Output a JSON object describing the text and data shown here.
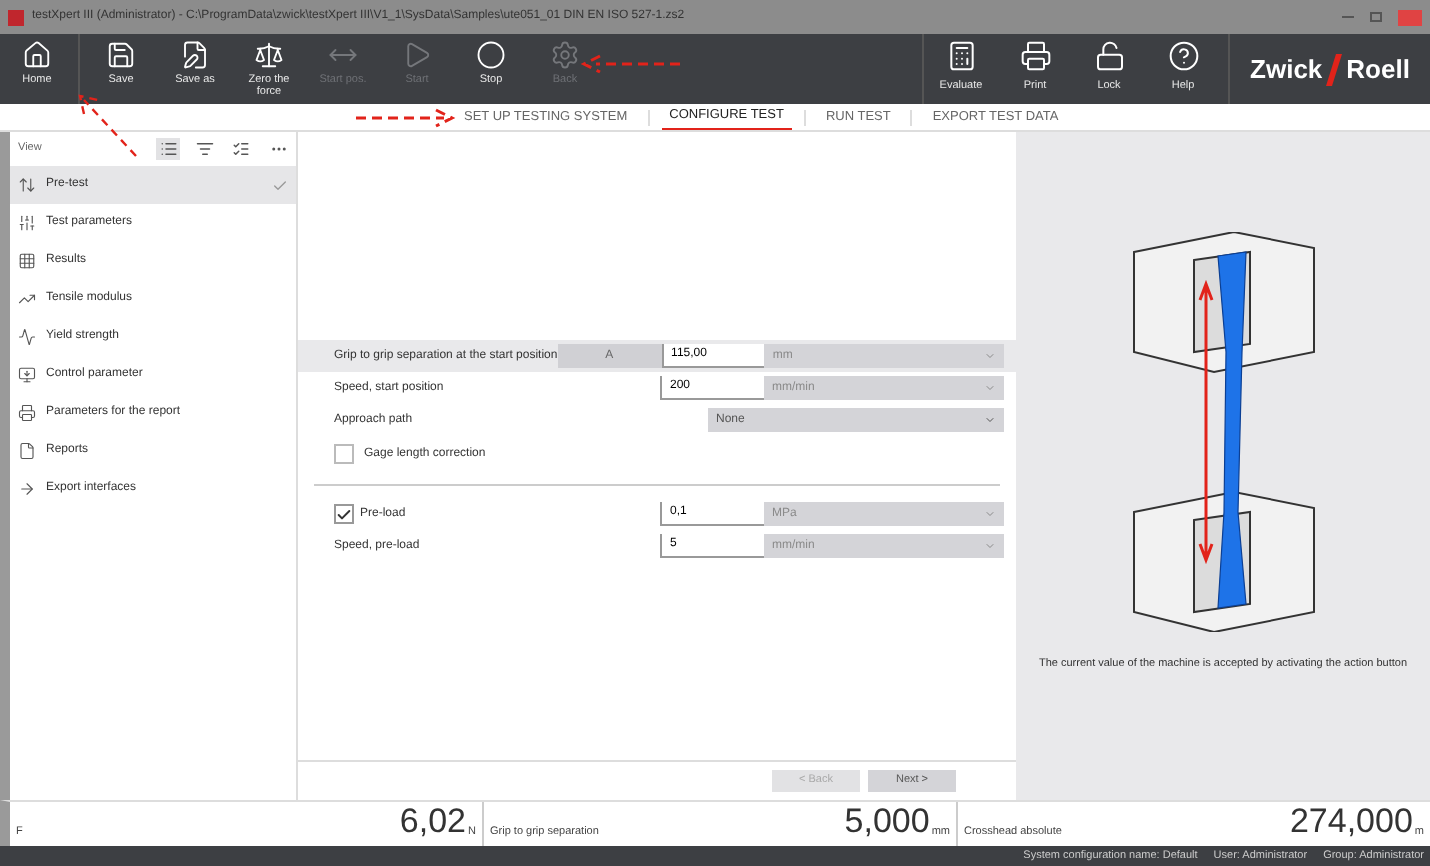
{
  "window": {
    "title": "testXpert III (Administrator) - C:\\ProgramData\\zwick\\testXpert III\\V1_1\\SysData\\Samples\\ute051_01 DIN EN ISO 527-1.zs2"
  },
  "toolbar": [
    {
      "label": "Home",
      "disabled": false
    },
    {
      "label": "Save",
      "disabled": false
    },
    {
      "label": "Save as",
      "disabled": false
    },
    {
      "label": "Zero the force",
      "disabled": false
    },
    {
      "label": "Start pos.",
      "disabled": true
    },
    {
      "label": "Start",
      "disabled": true
    },
    {
      "label": "Stop",
      "disabled": false
    },
    {
      "label": "Back",
      "disabled": true
    }
  ],
  "toolbar_right": [
    {
      "label": "Evaluate"
    },
    {
      "label": "Print"
    },
    {
      "label": "Lock"
    },
    {
      "label": "Help"
    }
  ],
  "logo": {
    "left": "Zwick",
    "right": "Roell"
  },
  "tabs": [
    {
      "label": "SET UP TESTING SYSTEM",
      "selected": false
    },
    {
      "label": "CONFIGURE TEST",
      "selected": true
    },
    {
      "label": "RUN TEST",
      "selected": false
    },
    {
      "label": "EXPORT TEST DATA",
      "selected": false
    }
  ],
  "sidebar": {
    "view_label": "View",
    "views": [
      {
        "selected": true
      },
      {
        "selected": false
      },
      {
        "selected": false
      }
    ],
    "items": [
      {
        "label": "Pre-test",
        "selected": true,
        "checked": true
      },
      {
        "label": "Test parameters",
        "selected": false,
        "checked": false
      },
      {
        "label": "Results",
        "selected": false,
        "checked": false
      },
      {
        "label": "Tensile modulus",
        "selected": false,
        "checked": false
      },
      {
        "label": "Yield strength",
        "selected": false,
        "checked": false
      },
      {
        "label": "Control parameter",
        "selected": false,
        "checked": false
      },
      {
        "label": "Parameters for the report",
        "selected": false,
        "checked": false
      },
      {
        "label": "Reports",
        "selected": false,
        "checked": false
      },
      {
        "label": "Export interfaces",
        "selected": false,
        "checked": false
      }
    ]
  },
  "form": [
    {
      "kind": "value",
      "label": "Grip to grip separation at the start position",
      "selected": true,
      "action": "A",
      "value": "115,00",
      "unit": "mm"
    },
    {
      "kind": "value",
      "label": "Speed, start position",
      "selected": false,
      "value": "200",
      "unit": "mm/min"
    },
    {
      "kind": "select",
      "label": "Approach path",
      "selected": false,
      "value": "None"
    },
    {
      "kind": "check",
      "label": "Gage length correction",
      "checked": false
    },
    {
      "kind": "divider"
    },
    {
      "kind": "checkvalue",
      "label": "Pre-load",
      "checked": true,
      "value": "0,1",
      "unit": "MPa"
    },
    {
      "kind": "value",
      "label": "Speed, pre-load",
      "selected": false,
      "value": "5",
      "unit": "mm/min"
    }
  ],
  "nav_buttons": [
    {
      "label": "< Back",
      "disabled": true
    },
    {
      "label": "Next >",
      "disabled": false
    }
  ],
  "caption": "The current value of the machine is accepted by activating the action button",
  "readouts": [
    {
      "label": "F",
      "value": "6,02",
      "unit": "N"
    },
    {
      "label": "Grip to grip separation",
      "value": "5,000",
      "unit": "mm"
    },
    {
      "label": "Crosshead absolute",
      "value": "274,000",
      "unit": "m"
    }
  ],
  "status_bar": [
    "System configuration name: Default",
    "User: Administrator",
    "Group: Administrator"
  ]
}
